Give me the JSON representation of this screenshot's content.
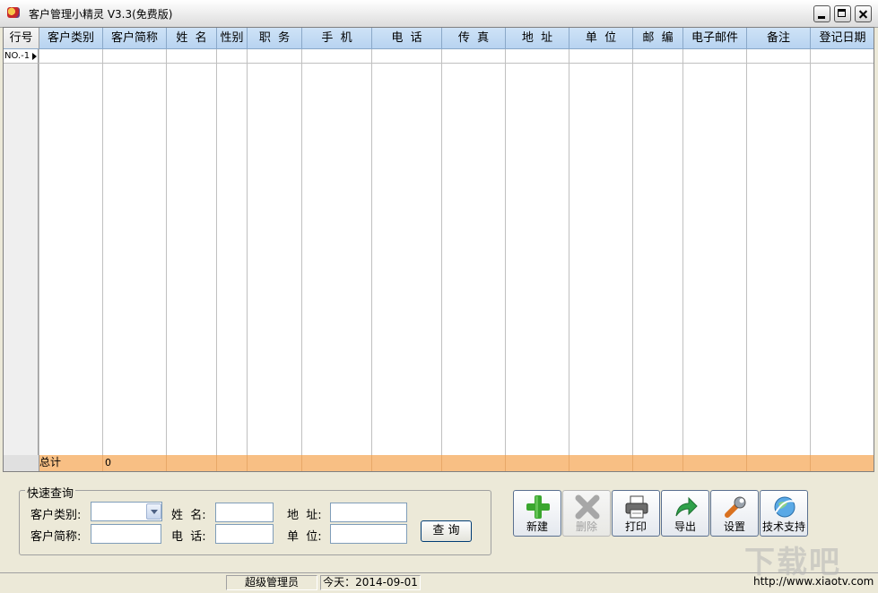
{
  "window": {
    "title": "客户管理小精灵 V3.3(免费版)"
  },
  "grid": {
    "columns": [
      {
        "key": "row",
        "label": "行号",
        "w": 40
      },
      {
        "key": "category",
        "label": "客户类别",
        "w": 71
      },
      {
        "key": "short_name",
        "label": "客户简称",
        "w": 71
      },
      {
        "key": "name",
        "label": "姓  名",
        "w": 56
      },
      {
        "key": "gender",
        "label": "性别",
        "w": 34
      },
      {
        "key": "title",
        "label": "职  务",
        "w": 61
      },
      {
        "key": "mobile",
        "label": "手  机",
        "w": 78
      },
      {
        "key": "phone",
        "label": "电  话",
        "w": 78
      },
      {
        "key": "fax",
        "label": "传  真",
        "w": 71
      },
      {
        "key": "address",
        "label": "地  址",
        "w": 71
      },
      {
        "key": "company",
        "label": "单  位",
        "w": 71
      },
      {
        "key": "zip",
        "label": "邮  编",
        "w": 56
      },
      {
        "key": "email",
        "label": "电子邮件",
        "w": 71
      },
      {
        "key": "remark",
        "label": "备注",
        "w": 71
      },
      {
        "key": "reg_date",
        "label": "登记日期",
        "w": 72
      }
    ],
    "row1_label": "NO.-1",
    "total_label": "总计",
    "total_count": "0"
  },
  "search": {
    "legend": "快速查询",
    "category_label": "客户类别:",
    "short_name_label": "客户简称:",
    "name_label": "姓  名:",
    "phone_label": "电  话:",
    "address_label": "地  址:",
    "company_label": "单  位:",
    "category_value": "",
    "short_name_value": "",
    "name_value": "",
    "phone_value": "",
    "address_value": "",
    "company_value": "",
    "query_button": "查 询"
  },
  "toolbar": {
    "new": "新建",
    "delete": "删除",
    "print": "打印",
    "export": "导出",
    "settings": "设置",
    "support": "技术支持"
  },
  "status": {
    "user": "超级管理员",
    "today": "今天：2014-09-01",
    "url": "http://www.xiaotv.com"
  },
  "watermark": "下载吧",
  "colors": {
    "header_bg": "#c4daf3",
    "total_row": "#f8bf84",
    "window_bg": "#ece9d8",
    "plus_green": "#3aa62e"
  }
}
